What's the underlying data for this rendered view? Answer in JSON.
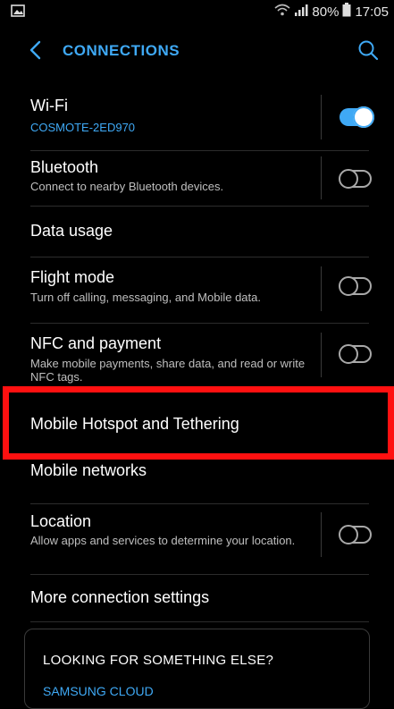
{
  "status_bar": {
    "battery": "80%",
    "time": "17:05",
    "icons": [
      "image-icon",
      "wifi-icon",
      "signal-icon",
      "battery-icon"
    ]
  },
  "app_bar": {
    "title": "CONNECTIONS",
    "back_icon": "chevron-left-icon",
    "search_icon": "search-icon",
    "accent": "#3fa9f5"
  },
  "items": [
    {
      "title": "Wi-Fi",
      "subtitle": "COSMOTE-2ED970",
      "toggle": "on"
    },
    {
      "title": "Bluetooth",
      "subtitle": "Connect to nearby Bluetooth devices.",
      "toggle": "off"
    },
    {
      "title": "Data usage"
    },
    {
      "title": "Flight mode",
      "subtitle": "Turn off calling, messaging, and Mobile data.",
      "toggle": "off"
    },
    {
      "title": "NFC and payment",
      "subtitle": "Make mobile payments, share data, and read or write NFC tags.",
      "toggle": "off"
    },
    {
      "title": "Mobile Hotspot and Tethering",
      "highlighted": true
    },
    {
      "title": "Mobile networks"
    },
    {
      "title": "Location",
      "subtitle": "Allow apps and services to determine your location.",
      "toggle": "off"
    },
    {
      "title": "More connection settings"
    }
  ],
  "card": {
    "title": "LOOKING FOR SOMETHING ELSE?",
    "link": "SAMSUNG CLOUD"
  },
  "colors": {
    "highlight": "#ff1010",
    "background": "#000000"
  }
}
